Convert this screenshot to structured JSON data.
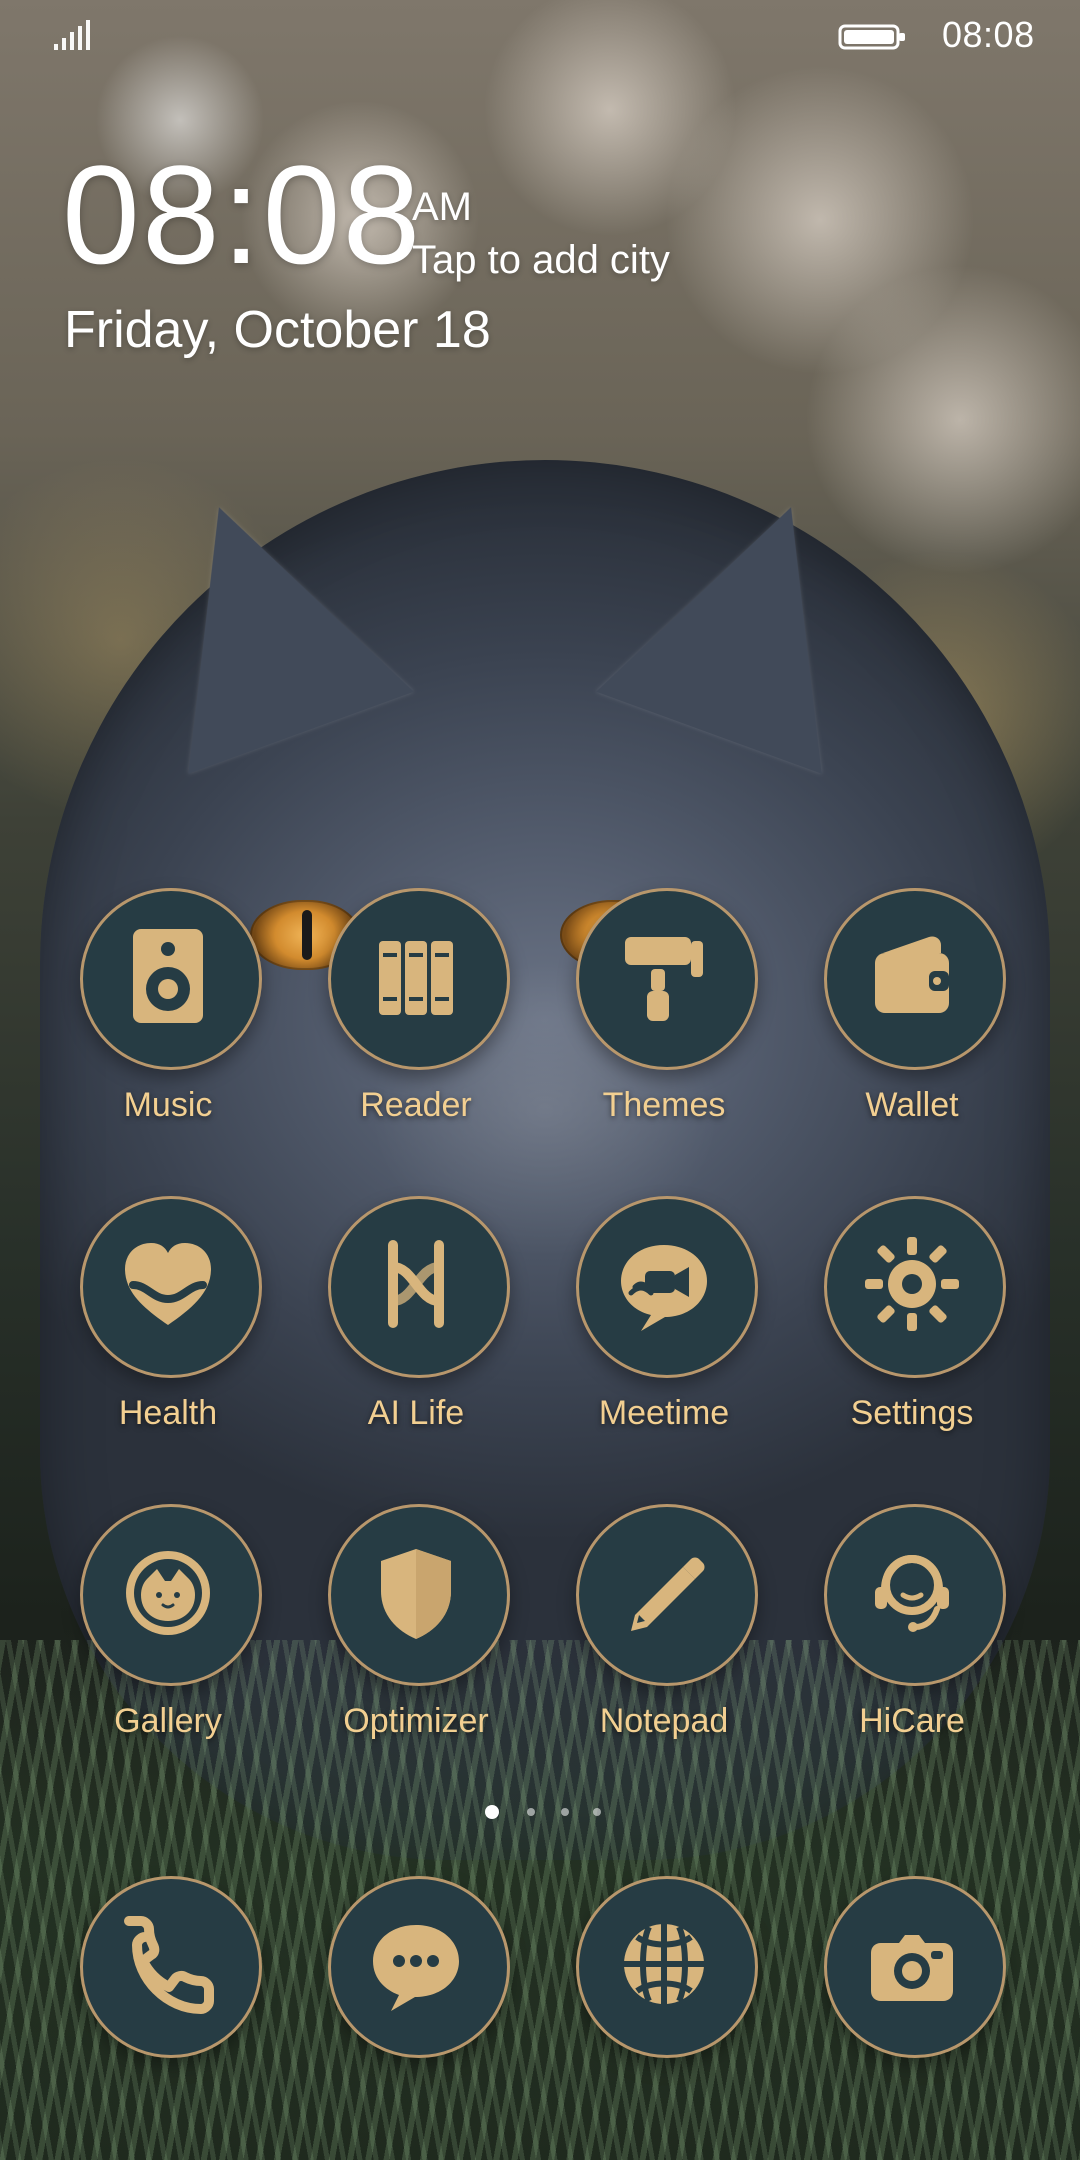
{
  "status_bar": {
    "time": "08:08"
  },
  "lockscreen": {
    "time": "08:08",
    "ampm": "AM",
    "weather_prompt": "Tap to add city",
    "date": "Friday, October 18"
  },
  "apps": [
    {
      "label": "Music",
      "icon": "music-icon"
    },
    {
      "label": "Reader",
      "icon": "reader-icon"
    },
    {
      "label": "Themes",
      "icon": "themes-icon"
    },
    {
      "label": "Wallet",
      "icon": "wallet-icon"
    },
    {
      "label": "Health",
      "icon": "health-icon"
    },
    {
      "label": "AI Life",
      "icon": "ai-life-icon"
    },
    {
      "label": "Meetime",
      "icon": "meetime-icon"
    },
    {
      "label": "Settings",
      "icon": "settings-icon"
    },
    {
      "label": "Gallery",
      "icon": "gallery-icon"
    },
    {
      "label": "Optimizer",
      "icon": "optimizer-icon"
    },
    {
      "label": "Notepad",
      "icon": "notepad-icon"
    },
    {
      "label": "HiCare",
      "icon": "hicare-icon"
    }
  ],
  "dock": [
    {
      "icon": "phone-icon"
    },
    {
      "icon": "messages-icon"
    },
    {
      "icon": "browser-icon"
    },
    {
      "icon": "camera-icon"
    }
  ],
  "page_indicator": {
    "pages": 4,
    "active": 1
  },
  "colors": {
    "icon_bg": "#263c44",
    "icon_border": "#b8976c",
    "icon_glyph": "#d8b57d",
    "label": "#f2cf91"
  }
}
